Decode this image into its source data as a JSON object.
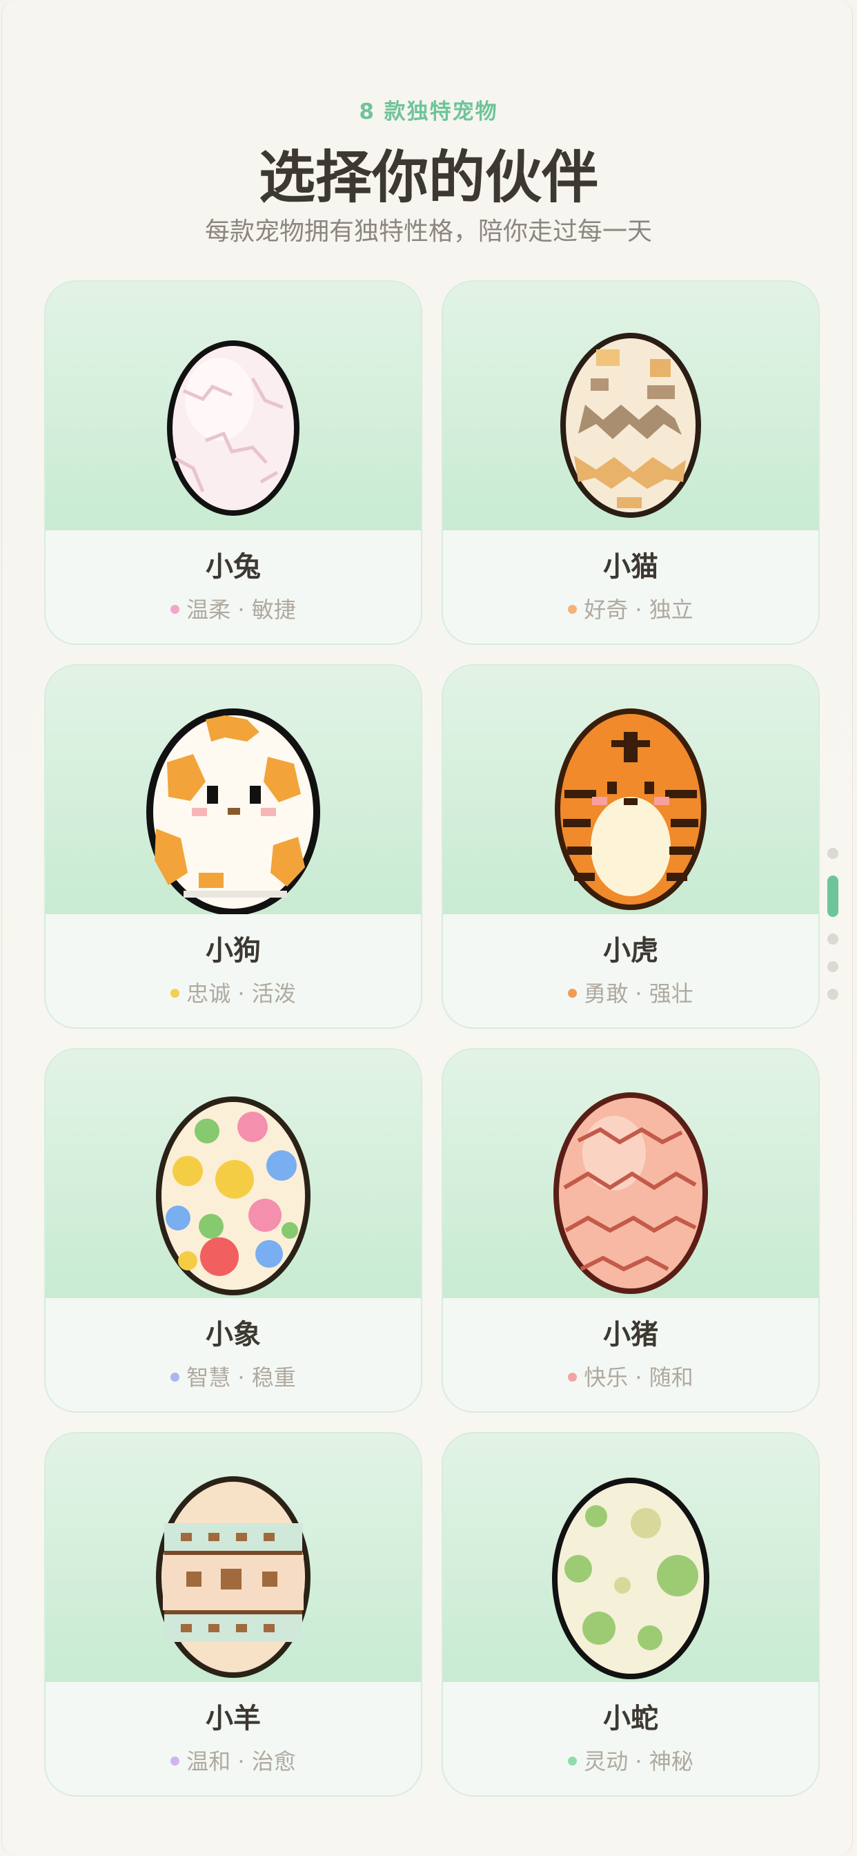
{
  "header": {
    "eyebrow": "8 款独特宠物",
    "title": "选择你的伙伴",
    "subtitle": "每款宠物拥有独特性格，陪你走过每一天"
  },
  "pets": [
    {
      "name": "小兔",
      "traits": "温柔 · 敏捷",
      "dot_color": "#f2a6c8",
      "egg": "white-cracked-egg-icon"
    },
    {
      "name": "小猫",
      "traits": "好奇 · 独立",
      "dot_color": "#f5b27a",
      "egg": "tabby-egg-icon"
    },
    {
      "name": "小狗",
      "traits": "忠诚 · 活泼",
      "dot_color": "#f3cf52",
      "egg": "dog-face-egg-icon"
    },
    {
      "name": "小虎",
      "traits": "勇敢 · 强壮",
      "dot_color": "#f39a55",
      "egg": "tiger-egg-icon"
    },
    {
      "name": "小象",
      "traits": "智慧 · 稳重",
      "dot_color": "#aab6f2",
      "egg": "flower-egg-icon"
    },
    {
      "name": "小猪",
      "traits": "快乐 · 随和",
      "dot_color": "#f3a3a3",
      "egg": "pink-zigzag-egg-icon"
    },
    {
      "name": "小羊",
      "traits": "温和 · 治愈",
      "dot_color": "#d1b3f2",
      "egg": "patterned-egg-icon"
    },
    {
      "name": "小蛇",
      "traits": "灵动 · 神秘",
      "dot_color": "#8fdcaa",
      "egg": "green-spotted-egg-icon"
    }
  ],
  "pager": {
    "count": 5,
    "active": 1
  }
}
